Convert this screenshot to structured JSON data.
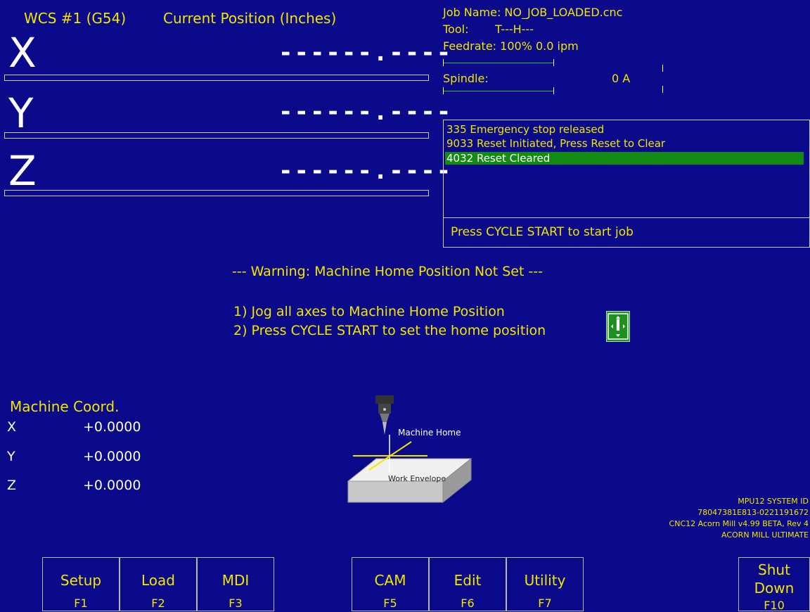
{
  "dro": {
    "wcs_label": "WCS #1 (G54)",
    "position_label": "Current Position (Inches)",
    "axes": [
      {
        "letter": "X",
        "value": "------.----"
      },
      {
        "letter": "Y",
        "value": "------.----"
      },
      {
        "letter": "Z",
        "value": "------.----"
      }
    ]
  },
  "job": {
    "job_name": "Job Name: NO_JOB_LOADED.cnc",
    "tool_label": "Tool:",
    "tool_value": "T---H---",
    "feedrate": "Feedrate: 100%  0.0 ipm",
    "spindle_label": "Spindle:",
    "spindle_value": "0  A"
  },
  "messages": [
    {
      "text": "335 Emergency stop released",
      "selected": false
    },
    {
      "text": "9033 Reset Initiated, Press Reset to Clear",
      "selected": false
    },
    {
      "text": "4032 Reset Cleared",
      "selected": true
    }
  ],
  "status": "Press CYCLE START to start job",
  "warning": {
    "title": "--- Warning: Machine Home Position Not Set ---",
    "step1": "1) Jog all axes to Machine Home Position",
    "step2": "2) Press CYCLE START to set the home position",
    "cycle_icon_glyph": "I"
  },
  "diagram": {
    "machine_home": "Machine Home",
    "work_envelope": "Work Envelope"
  },
  "machine_coord": {
    "title": "Machine Coord.",
    "axes": [
      {
        "letter": "X",
        "value": "+0.0000"
      },
      {
        "letter": "Y",
        "value": "+0.0000"
      },
      {
        "letter": "Z",
        "value": "+0.0000"
      }
    ]
  },
  "system": {
    "line1": "MPU12 SYSTEM ID",
    "line2": "78047381E813-0221191672",
    "line3": "CNC12 Acorn Mill v4.99 BETA, Rev 4",
    "line4": "ACORN MILL ULTIMATE"
  },
  "fkeys": [
    {
      "label": "Setup",
      "key": "F1"
    },
    {
      "label": "Load",
      "key": "F2"
    },
    {
      "label": "MDI",
      "key": "F3"
    },
    {
      "label": "CAM",
      "key": "F5"
    },
    {
      "label": "Edit",
      "key": "F6"
    },
    {
      "label": "Utility",
      "key": "F7"
    },
    {
      "label_line1": "Shut",
      "label_line2": "Down",
      "key": "F10"
    }
  ],
  "colors": {
    "background": "#0a0a8a",
    "text": "#f2e600",
    "selected_message": "#138a13",
    "indicator_green": "#27c227"
  }
}
